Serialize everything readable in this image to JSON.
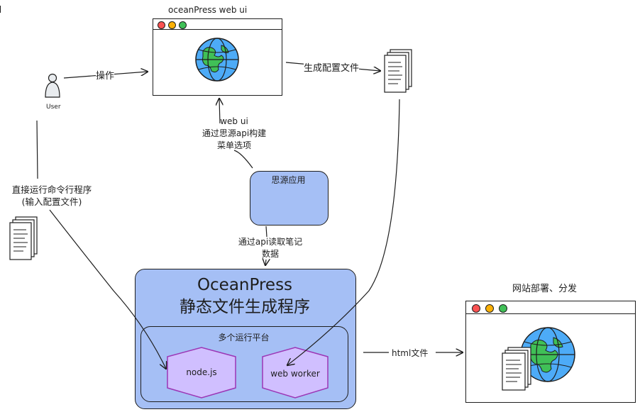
{
  "labels": {
    "window_title": "oceanPress web ui",
    "user": "User",
    "operate": "操作",
    "gen_config": "生成配置文件",
    "webui_line1": "web ui",
    "webui_line2": "通过思源api构建",
    "webui_line3": "菜单选项",
    "siyuan_app": "思源应用",
    "cli_line1": "直接运行命令行程序",
    "cli_line2": "(输入配置文件)",
    "read_notes_line1": "通过api读取笔记",
    "read_notes_line2": "数据",
    "engine_title": "OceanPress",
    "engine_subtitle": "静态文件生成程序",
    "platforms": "多个运行平台",
    "nodejs": "node.js",
    "webworker": "web worker",
    "html_files": "html文件",
    "deploy": "网站部署、分发"
  },
  "colors": {
    "stroke": "#1e1e1e",
    "box_fill": "#a5bff5",
    "hex_fill": "#d0bfff",
    "hex_stroke": "#9c36b5",
    "globe_blue": "#4dabf7",
    "globe_land": "#40c057",
    "dot_red": "#fa5252",
    "dot_yellow": "#fab005",
    "dot_green": "#40c057"
  }
}
